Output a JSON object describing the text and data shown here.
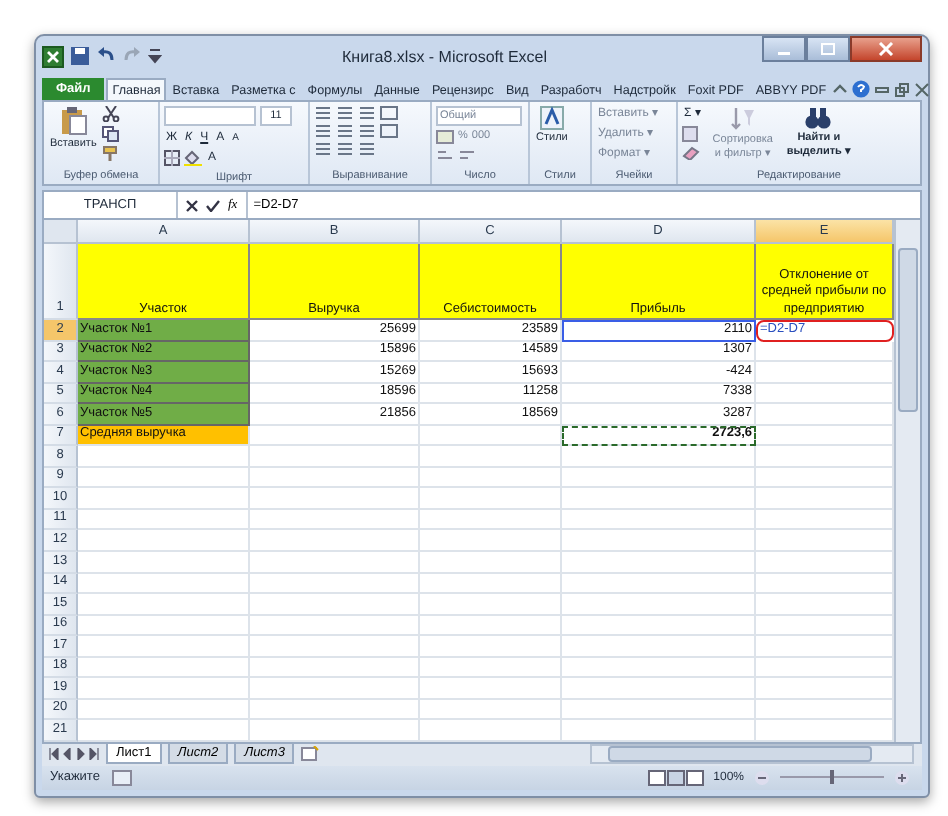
{
  "window": {
    "title": "Книга8.xlsx - Microsoft Excel"
  },
  "ribbon_tabs": [
    {
      "label": "Файл",
      "kind": "file",
      "selected": false
    },
    {
      "label": "Главная",
      "kind": "tab",
      "selected": true
    },
    {
      "label": "Вставка",
      "kind": "tab",
      "selected": false
    },
    {
      "label": "Разметка с",
      "kind": "tab",
      "selected": false
    },
    {
      "label": "Формулы",
      "kind": "tab",
      "selected": false
    },
    {
      "label": "Данные",
      "kind": "tab",
      "selected": false
    },
    {
      "label": "Рецензирс",
      "kind": "tab",
      "selected": false
    },
    {
      "label": "Вид",
      "kind": "tab",
      "selected": false
    },
    {
      "label": "Разработч",
      "kind": "tab",
      "selected": false
    },
    {
      "label": "Надстройк",
      "kind": "tab",
      "selected": false
    },
    {
      "label": "Foxit PDF",
      "kind": "tab",
      "selected": false
    },
    {
      "label": "ABBYY PDF",
      "kind": "tab",
      "selected": false
    }
  ],
  "ribbon": {
    "paste": "Вставить",
    "font_size": "11",
    "bold": "Ж",
    "italic": "К",
    "underline": "Ч",
    "grow": "A",
    "shrink": "A",
    "font_color": "A",
    "number_format": "Общий",
    "percent": "%",
    "thousands": "000",
    "styles": "Стили",
    "insert": "Вставить ▾",
    "delete": "Удалить ▾",
    "format": "Формат ▾",
    "sum": "Σ ▾",
    "sort": "Сортировка и фильтр ▾",
    "find": "Найти и выделить ▾",
    "groups": [
      "Буфер обмена",
      "Шрифт",
      "Выравнивание",
      "Число",
      "Стили",
      "Ячейки",
      "Редактирование"
    ]
  },
  "formula_bar": {
    "name_box": "ТРАНСП",
    "fx": "fx",
    "formula": "=D2-D7"
  },
  "columns": [
    {
      "label": "A",
      "selected": false
    },
    {
      "label": "B",
      "selected": false
    },
    {
      "label": "C",
      "selected": false
    },
    {
      "label": "D",
      "selected": false
    },
    {
      "label": "E",
      "selected": true
    }
  ],
  "rows": [
    {
      "number": "1",
      "kind": "header",
      "selected": false,
      "cells": [
        {
          "text": "Участок"
        },
        {
          "text": "Выручка"
        },
        {
          "text": "Себистоимость"
        },
        {
          "text": "Прибыль"
        },
        {
          "text": "Отклонение от средней прибыли по предприятию"
        }
      ]
    },
    {
      "number": "2",
      "kind": "data",
      "selected": true,
      "cells": [
        {
          "text": "Участок №1",
          "range_ref": false,
          "marquee": false,
          "editing": false
        },
        {
          "text": "25699",
          "range_ref": false,
          "marquee": false,
          "editing": false
        },
        {
          "text": "23589",
          "range_ref": false,
          "marquee": false,
          "editing": false
        },
        {
          "text": "2110",
          "range_ref": true,
          "marquee": false,
          "editing": false
        },
        {
          "text": "=D2-D7",
          "range_ref": false,
          "marquee": false,
          "editing": true
        }
      ]
    },
    {
      "number": "3",
      "kind": "data",
      "selected": false,
      "cells": [
        {
          "text": "Участок №2",
          "range_ref": false,
          "marquee": false,
          "editing": false
        },
        {
          "text": "15896",
          "range_ref": false,
          "marquee": false,
          "editing": false
        },
        {
          "text": "14589",
          "range_ref": false,
          "marquee": false,
          "editing": false
        },
        {
          "text": "1307",
          "range_ref": false,
          "marquee": false,
          "editing": false
        }
      ]
    },
    {
      "number": "4",
      "kind": "data",
      "selected": false,
      "cells": [
        {
          "text": "Участок №3",
          "range_ref": false,
          "marquee": false,
          "editing": false
        },
        {
          "text": "15269",
          "range_ref": false,
          "marquee": false,
          "editing": false
        },
        {
          "text": "15693",
          "range_ref": false,
          "marquee": false,
          "editing": false
        },
        {
          "text": "-424",
          "range_ref": false,
          "marquee": false,
          "editing": false
        }
      ]
    },
    {
      "number": "5",
      "kind": "data",
      "selected": false,
      "cells": [
        {
          "text": "Участок №4",
          "range_ref": false,
          "marquee": false,
          "editing": false
        },
        {
          "text": "18596",
          "range_ref": false,
          "marquee": false,
          "editing": false
        },
        {
          "text": "11258",
          "range_ref": false,
          "marquee": false,
          "editing": false
        },
        {
          "text": "7338",
          "range_ref": false,
          "marquee": false,
          "editing": false
        }
      ]
    },
    {
      "number": "6",
      "kind": "data",
      "selected": false,
      "cells": [
        {
          "text": "Участок №5",
          "range_ref": false,
          "marquee": false,
          "editing": false
        },
        {
          "text": "21856",
          "range_ref": false,
          "marquee": false,
          "editing": false
        },
        {
          "text": "18569",
          "range_ref": false,
          "marquee": false,
          "editing": false
        },
        {
          "text": "3287",
          "range_ref": false,
          "marquee": false,
          "editing": false
        }
      ]
    },
    {
      "number": "7",
      "kind": "total",
      "selected": false,
      "cells": [
        {
          "text": "Средняя выручка",
          "range_ref": false,
          "marquee": false,
          "editing": false
        },
        {
          "text": "2723,6",
          "range_ref": false,
          "marquee": true,
          "editing": false
        }
      ]
    },
    {
      "number": "8",
      "kind": "empty",
      "selected": false,
      "cells": []
    },
    {
      "number": "9",
      "kind": "empty",
      "selected": false,
      "cells": []
    },
    {
      "number": "10",
      "kind": "empty",
      "selected": false,
      "cells": []
    },
    {
      "number": "11",
      "kind": "empty",
      "selected": false,
      "cells": []
    },
    {
      "number": "12",
      "kind": "empty",
      "selected": false,
      "cells": []
    },
    {
      "number": "13",
      "kind": "empty",
      "selected": false,
      "cells": []
    },
    {
      "number": "14",
      "kind": "empty",
      "selected": false,
      "cells": []
    },
    {
      "number": "15",
      "kind": "empty",
      "selected": false,
      "cells": []
    },
    {
      "number": "16",
      "kind": "empty",
      "selected": false,
      "cells": []
    },
    {
      "number": "17",
      "kind": "empty",
      "selected": false,
      "cells": []
    },
    {
      "number": "18",
      "kind": "empty",
      "selected": false,
      "cells": []
    },
    {
      "number": "19",
      "kind": "empty",
      "selected": false,
      "cells": []
    },
    {
      "number": "20",
      "kind": "empty",
      "selected": false,
      "cells": []
    },
    {
      "number": "21",
      "kind": "empty",
      "selected": false,
      "cells": []
    }
  ],
  "sheet_tabs": [
    {
      "label": "Лист1",
      "selected": true
    },
    {
      "label": "Лист2",
      "selected": false
    },
    {
      "label": "Лист3",
      "selected": false
    }
  ],
  "status_bar": {
    "mode": "Укажите",
    "zoom": "100%",
    "zoom_slider": {
      "level": 0.5
    }
  }
}
